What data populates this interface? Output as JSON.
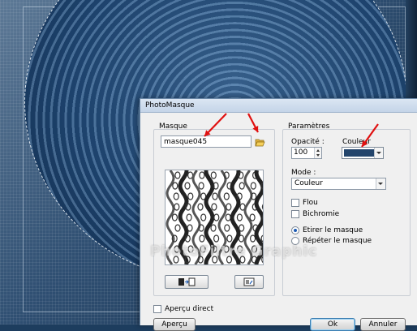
{
  "dialog": {
    "title": "PhotoMasque",
    "masque": {
      "group_label": "Masque",
      "file_value": "masque045",
      "browse_icon": "folder-open-icon",
      "invert_icon": "invert-mask-icon",
      "edit_icon": "edit-mask-icon"
    },
    "params": {
      "group_label": "Paramètres",
      "opacity_label": "Opacité :",
      "opacity_value": "100",
      "color_label": "Couleur",
      "color_value": "#23456c",
      "mode_label": "Mode :",
      "mode_value": "Couleur",
      "flou_label": "Flou",
      "bichromie_label": "Bichromie",
      "stretch_label": "Etirer le masque",
      "repeat_label": "Répéter le masque",
      "stretch_selected": true
    },
    "apercu_direct_label": "Aperçu direct",
    "buttons": {
      "preview": "Aperçu",
      "ok": "Ok",
      "cancel": "Annuler"
    },
    "accent_red": "#e01010"
  },
  "watermark": "PhotoFiltre Graphic"
}
